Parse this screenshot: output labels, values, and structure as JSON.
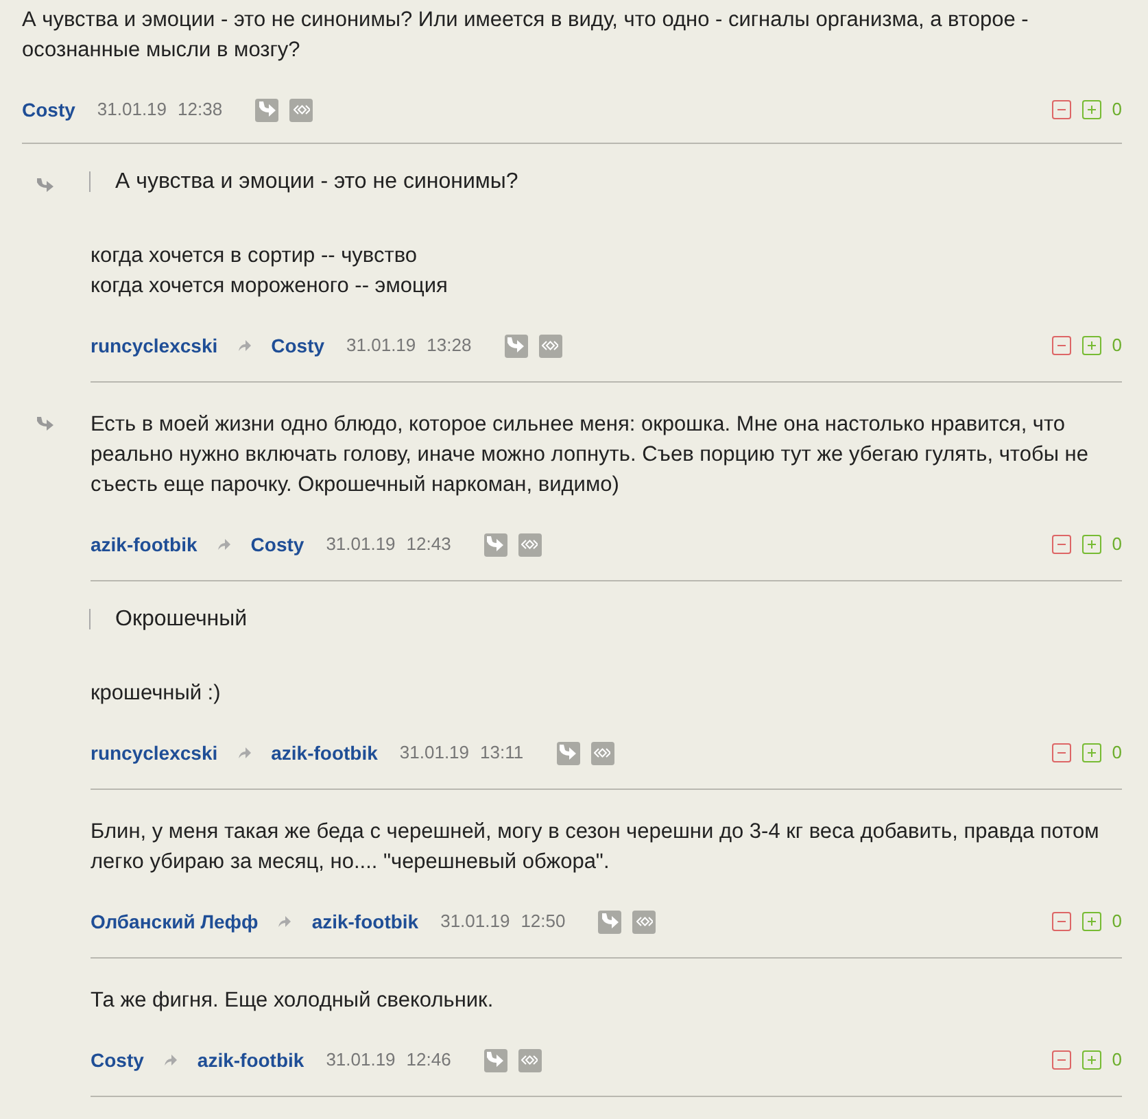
{
  "comments": [
    {
      "marked": false,
      "lines": [
        "А чувства и эмоции - это не синонимы? Или имеется в виду, что одно - сигналы организма, а второе - осознанные мысли в мозгу?"
      ],
      "author": "Costy",
      "date": "31.01.19",
      "time": "12:38",
      "score": "0",
      "children": [
        {
          "marked": true,
          "quote": "А чувства и эмоции - это не синонимы?",
          "lines": [
            "когда хочется в сортир -- чувство",
            "когда хочется мороженого -- эмоция"
          ],
          "author": "runcyclexcski",
          "reply_to": "Costy",
          "date": "31.01.19",
          "time": "13:28",
          "score": "0"
        },
        {
          "marked": true,
          "lines": [
            "Есть в моей жизни одно блюдо, которое сильнее меня: окрошка. Мне она настолько нравится, что реально нужно включать голову, иначе можно лопнуть. Съев порцию тут же убегаю гулять, чтобы не съесть еще парочку. Окрошечный наркоман, видимо)"
          ],
          "author": "azik-footbik",
          "reply_to": "Costy",
          "date": "31.01.19",
          "time": "12:43",
          "score": "0"
        },
        {
          "marked": false,
          "quote": "Окрошечный",
          "lines": [
            "крошечный :)"
          ],
          "author": "runcyclexcski",
          "reply_to": "azik-footbik",
          "date": "31.01.19",
          "time": "13:11",
          "score": "0"
        },
        {
          "marked": false,
          "lines": [
            "Блин, у меня такая же беда с черешней, могу в сезон черешни до 3-4 кг веса добавить, правда потом легко убираю за месяц, но.... \"черешневый обжора\"."
          ],
          "author": "Олбанский Лефф",
          "reply_to": "azik-footbik",
          "date": "31.01.19",
          "time": "12:50",
          "score": "0"
        },
        {
          "marked": false,
          "lines": [
            "Та же фигня. Еще холодный свекольник."
          ],
          "author": "Costy",
          "reply_to": "azik-footbik",
          "date": "31.01.19",
          "time": "12:46",
          "score": "0"
        }
      ]
    }
  ]
}
